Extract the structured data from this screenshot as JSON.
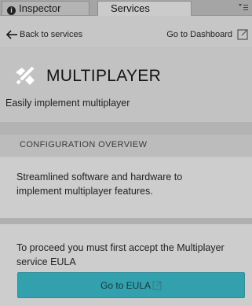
{
  "tabs": {
    "inspector": "Inspector",
    "services": "Services"
  },
  "nav": {
    "back": "Back to services",
    "dashboard": "Go to Dashboard"
  },
  "header": {
    "title": "MULTIPLAYER",
    "subtitle": "Easily implement multiplayer"
  },
  "section": {
    "label": "CONFIGURATION OVERVIEW"
  },
  "overview": {
    "text": "Streamlined software and hardware to implement multiplayer features."
  },
  "eula": {
    "text": "To proceed you must first accept the Multiplayer service EULA",
    "button": "Go to EULA"
  },
  "colors": {
    "accent": "#33a1ad",
    "panel": "#c2c2c2"
  },
  "icons": {
    "inspector": "info-icon",
    "menu": "menu-icon",
    "back": "arrow-left-icon",
    "external": "external-link-icon",
    "service": "multiplayer-icon"
  }
}
